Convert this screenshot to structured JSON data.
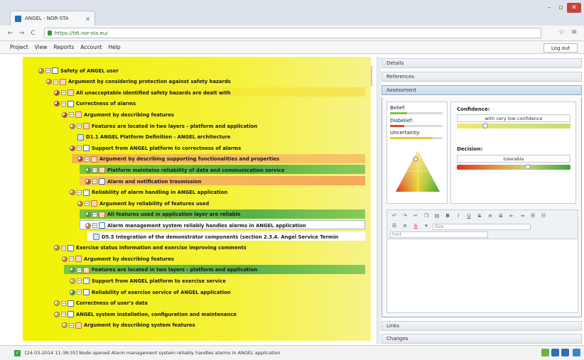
{
  "browser": {
    "tab_title": "ANGEL - NOR-STA",
    "tab_close": "×",
    "url": "https://fdt.nor-sta.eu/",
    "back": "←",
    "forward": "→",
    "reload": "C",
    "star": "☆",
    "menu": "≡",
    "win_min": "–",
    "win_max": "▫",
    "win_close": "✕"
  },
  "menubar": {
    "items": [
      "Project",
      "View",
      "Reports",
      "Account",
      "Help"
    ],
    "logout": "Log out"
  },
  "tree": {
    "rows": [
      {
        "text": "Safety of ANGEL user",
        "indent": 0,
        "icon": "blue",
        "pie": "#e07b2a"
      },
      {
        "text": "Argument by considering protection against safety hazards",
        "indent": 1,
        "icon": "red",
        "pie": "#e07b2a"
      },
      {
        "text": "All unacceptable identified safety hazards are dealt with",
        "indent": 2,
        "icon": "red",
        "pie": "#d23a2a"
      },
      {
        "text": "Correctness of alarms",
        "indent": 2,
        "icon": "blue",
        "pie": "#d23a2a"
      },
      {
        "text": "Argument by describing features",
        "indent": 3,
        "icon": "red",
        "pie": "#d23a2a"
      },
      {
        "text": "Features are located in two layers - platform and application",
        "indent": 4,
        "icon": "red",
        "pie": "#e07b2a"
      },
      {
        "text": "D1.1 ANGEL Platform Definition - ANGEL architecture",
        "indent": 5,
        "icon": "doc",
        "pie": ""
      },
      {
        "text": "Support from ANGEL platform to correctness of alarms",
        "indent": 4,
        "icon": "blue",
        "pie": "#d23a2a"
      },
      {
        "text": "Argument by describing supporting functionalities and properties",
        "indent": 5,
        "icon": "red",
        "pie": "#d23a2a"
      },
      {
        "text": "Platform maintains reliability of data and communication service",
        "indent": 6,
        "icon": "red",
        "pie": "#3aa03a"
      },
      {
        "text": "Alarm and notification trasmission",
        "indent": 6,
        "icon": "blue",
        "pie": "#d23a2a"
      },
      {
        "text": "Reliability of alarm handling in ANGEL application",
        "indent": 4,
        "icon": "blue",
        "pie": "#e07b2a"
      },
      {
        "text": "Argument by reliability of features used",
        "indent": 5,
        "icon": "red",
        "pie": "#e07b2a"
      },
      {
        "text": "All features used in application layer are reliable",
        "indent": 6,
        "icon": "red",
        "pie": "#3aa03a"
      },
      {
        "text": "Alarm management system reliably handles alarms in ANGEL application",
        "indent": 6,
        "icon": "blue",
        "pie": "#e07b2a"
      },
      {
        "text": "D5.5 Integration of the demonstrator components (section 2.3.4. Angel Service Termin",
        "indent": 7,
        "icon": "doc",
        "pie": ""
      },
      {
        "text": "Exercise status information and exercise improving comments",
        "indent": 2,
        "icon": "blue",
        "pie": "#e07b2a"
      },
      {
        "text": "Argument by describing features",
        "indent": 3,
        "icon": "red",
        "pie": "#e07b2a"
      },
      {
        "text": "Features are located in two layers - platform and application",
        "indent": 4,
        "icon": "red",
        "pie": "#3aa03a"
      },
      {
        "text": "Support from ANGEL platform to exercise service",
        "indent": 4,
        "icon": "blue",
        "pie": "#e0b02a"
      },
      {
        "text": "Reliability of exercise service of ANGEL application",
        "indent": 4,
        "icon": "blue",
        "pie": "#3aa03a"
      },
      {
        "text": "Correctness of user's data",
        "indent": 2,
        "icon": "blue",
        "pie": "#e0b02a"
      },
      {
        "text": "ANGEL system installation, configuration and maintenance",
        "indent": 2,
        "icon": "blue",
        "pie": "#e0b02a"
      },
      {
        "text": "Argument by describing system features",
        "indent": 3,
        "icon": "red",
        "pie": "#e0b02a"
      }
    ]
  },
  "right_panel": {
    "sections": {
      "details": "Details",
      "references": "References",
      "assessment": "Assessment",
      "links": "Links",
      "changes": "Changes"
    },
    "assessment": {
      "belief_label": "Belief:",
      "disbelief_label": "Disbelief:",
      "uncertainty_label": "Uncertainty:",
      "confidence_label": "Confidence:",
      "confidence_value": "with very low confidence",
      "decision_label": "Decision:",
      "decision_value": "tolerable"
    },
    "editor": {
      "bold": "B",
      "italic": "I",
      "underline": "U",
      "strike": "S",
      "font_color": "A",
      "size_placeholder": "Size",
      "font_placeholder": "Font"
    }
  },
  "status": {
    "message": "[24-03-2014 11:38:35] Node opened Alarm management system reliably handles alarms in ANGEL application"
  },
  "colors": {
    "accent": "#1e6fb8",
    "tree_yellow": "#f2f200",
    "tree_orange": "#f6b04b",
    "tree_green": "#4caf50",
    "close_red": "#c7443b"
  }
}
